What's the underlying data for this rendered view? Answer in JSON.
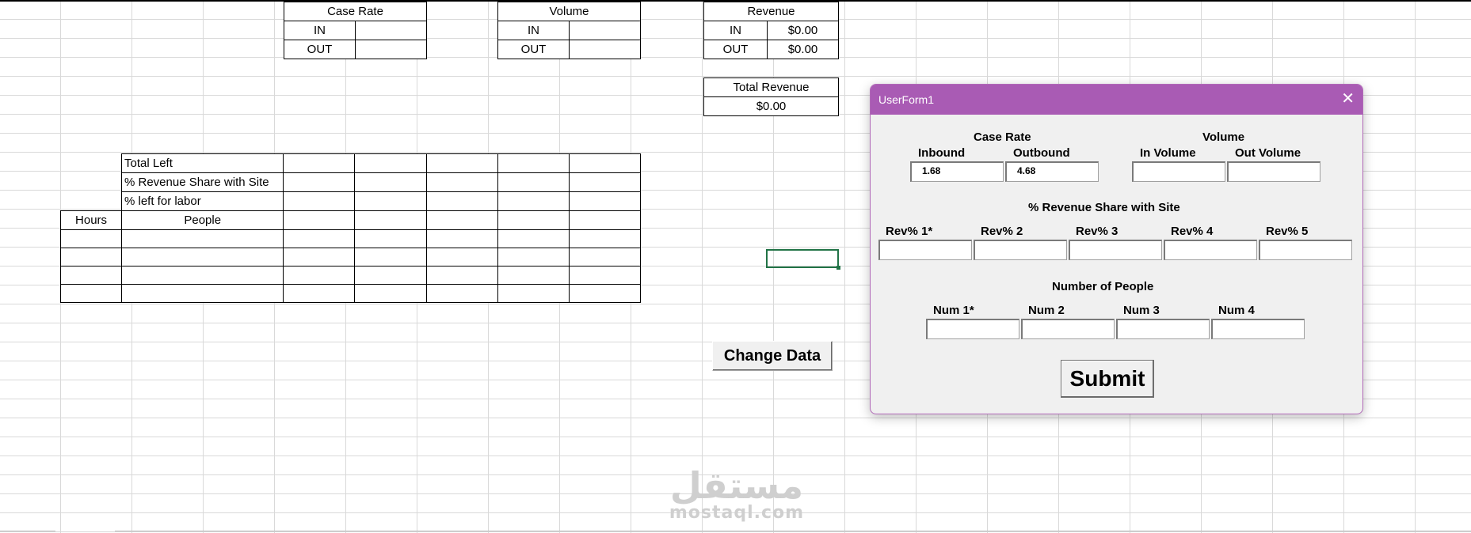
{
  "sheet": {
    "case_rate": {
      "title": "Case Rate",
      "in_label": "IN",
      "out_label": "OUT",
      "in_value": "",
      "out_value": ""
    },
    "volume": {
      "title": "Volume",
      "in_label": "IN",
      "out_label": "OUT",
      "in_value": "",
      "out_value": ""
    },
    "revenue": {
      "title": "Revenue",
      "in_label": "IN",
      "out_label": "OUT",
      "in_value": "$0.00",
      "out_value": "$0.00"
    },
    "total_revenue": {
      "title": "Total Revenue",
      "value": "$0.00"
    },
    "labor_table": {
      "row_labels": [
        "Total Left",
        "% Revenue Share with Site",
        "% left for labor"
      ],
      "hours_header": "Hours",
      "people_header": "People"
    },
    "change_button": "Change Data"
  },
  "userform": {
    "title": "UserForm1",
    "close_icon": "close-icon",
    "case_rate_heading": "Case Rate",
    "inbound_label": "Inbound",
    "outbound_label": "Outbound",
    "inbound_value": "1.68",
    "outbound_value": "4.68",
    "volume_heading": "Volume",
    "in_volume_label": "In Volume",
    "out_volume_label": "Out Volume",
    "in_volume_value": "",
    "out_volume_value": "",
    "rev_share_heading": "% Revenue Share with Site",
    "rev_labels": [
      "Rev% 1*",
      "Rev% 2",
      "Rev% 3",
      "Rev% 4",
      "Rev% 5"
    ],
    "people_heading": "Number of People",
    "num_labels": [
      "Num 1*",
      "Num 2",
      "Num 3",
      "Num 4"
    ],
    "submit_label": "Submit"
  },
  "watermark": {
    "arabic": "مستقل",
    "latin": "mostaql.com"
  }
}
